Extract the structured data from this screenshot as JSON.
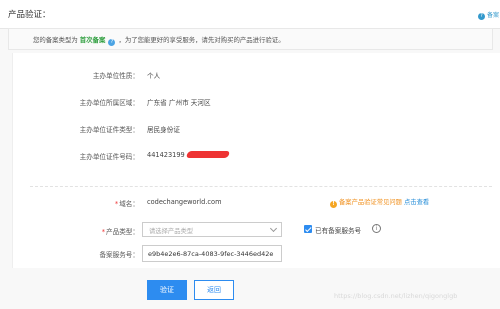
{
  "header": {
    "title": "产品验证：",
    "help_text": "备案"
  },
  "notice": {
    "prefix": "您的备案类型为",
    "type": "首次备案",
    "suffix": "，为了您能更好的享受服务，请先对购买的产品进行验证。"
  },
  "info_rows": [
    {
      "label": "主办单位性质：",
      "value": "个人"
    },
    {
      "label": "主办单位所属区域：",
      "value": "广东省 广州市 天河区"
    },
    {
      "label": "主办单位证件类型：",
      "value": "居民身份证"
    },
    {
      "label": "主办单位证件号码：",
      "value": "441423199"
    }
  ],
  "form": {
    "domain_label": "域名：",
    "domain_value": "codechangeworld.com",
    "faq_text": "备案产品验证常见问题",
    "faq_link": "点击查看",
    "product_type_label": "产品类型：",
    "product_type_placeholder": "请选择产品类型",
    "has_service_code_label": "已有备案服务号",
    "service_code_label": "备案服务号：",
    "service_code_value": "e9b4e2e6-87ca-4083-9fec-3446ed42e"
  },
  "buttons": {
    "verify": "验证",
    "back": "返回"
  },
  "watermark": "https://blog.csdn.net/lizhen/qigonglgb",
  "colors": {
    "primary": "#2d8cf0",
    "highlight_green": "#2e9e3e",
    "required_red": "#e33",
    "warning_orange": "#f5a623"
  }
}
